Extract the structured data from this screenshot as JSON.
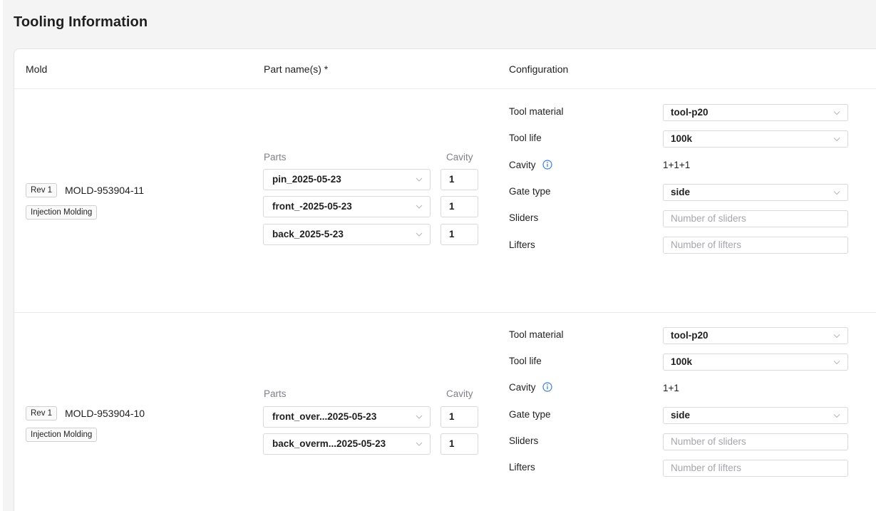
{
  "page": {
    "title": "Tooling Information"
  },
  "table": {
    "headers": {
      "mold": "Mold",
      "parts": "Part name(s) *",
      "configuration": "Configuration"
    }
  },
  "rows": [
    {
      "rev": "Rev 1",
      "mold_id": "MOLD-953904-11",
      "process": "Injection Molding",
      "parts_label": "Parts",
      "cavity_label": "Cavity",
      "parts": [
        {
          "name": "pin_2025-05-23",
          "cavity": "1"
        },
        {
          "name": "front_-2025-05-23",
          "cavity": "1"
        },
        {
          "name": "back_2025-5-23",
          "cavity": "1"
        }
      ],
      "config": {
        "tool_material_label": "Tool material",
        "tool_material": "tool-p20",
        "tool_life_label": "Tool life",
        "tool_life": "100k",
        "cavity_label": "Cavity",
        "cavity": "1+1+1",
        "gate_type_label": "Gate type",
        "gate_type": "side",
        "sliders_label": "Sliders",
        "sliders_placeholder": "Number of sliders",
        "lifters_label": "Lifters",
        "lifters_placeholder": "Number of lifters"
      }
    },
    {
      "rev": "Rev 1",
      "mold_id": "MOLD-953904-10",
      "process": "Injection Molding",
      "parts_label": "Parts",
      "cavity_label": "Cavity",
      "parts": [
        {
          "name": "front_over...2025-05-23",
          "cavity": "1"
        },
        {
          "name": "back_overm...2025-05-23",
          "cavity": "1"
        }
      ],
      "config": {
        "tool_material_label": "Tool material",
        "tool_material": "tool-p20",
        "tool_life_label": "Tool life",
        "tool_life": "100k",
        "cavity_label": "Cavity",
        "cavity": "1+1",
        "gate_type_label": "Gate type",
        "gate_type": "side",
        "sliders_label": "Sliders",
        "sliders_placeholder": "Number of sliders",
        "lifters_label": "Lifters",
        "lifters_placeholder": "Number of lifters"
      }
    }
  ],
  "icons": {
    "dropdown": "chevron-down-icon",
    "info": "info-icon"
  },
  "colors": {
    "info_blue": "#3b7ddd",
    "placeholder": "#a5a5ab",
    "muted_label": "#808087"
  }
}
